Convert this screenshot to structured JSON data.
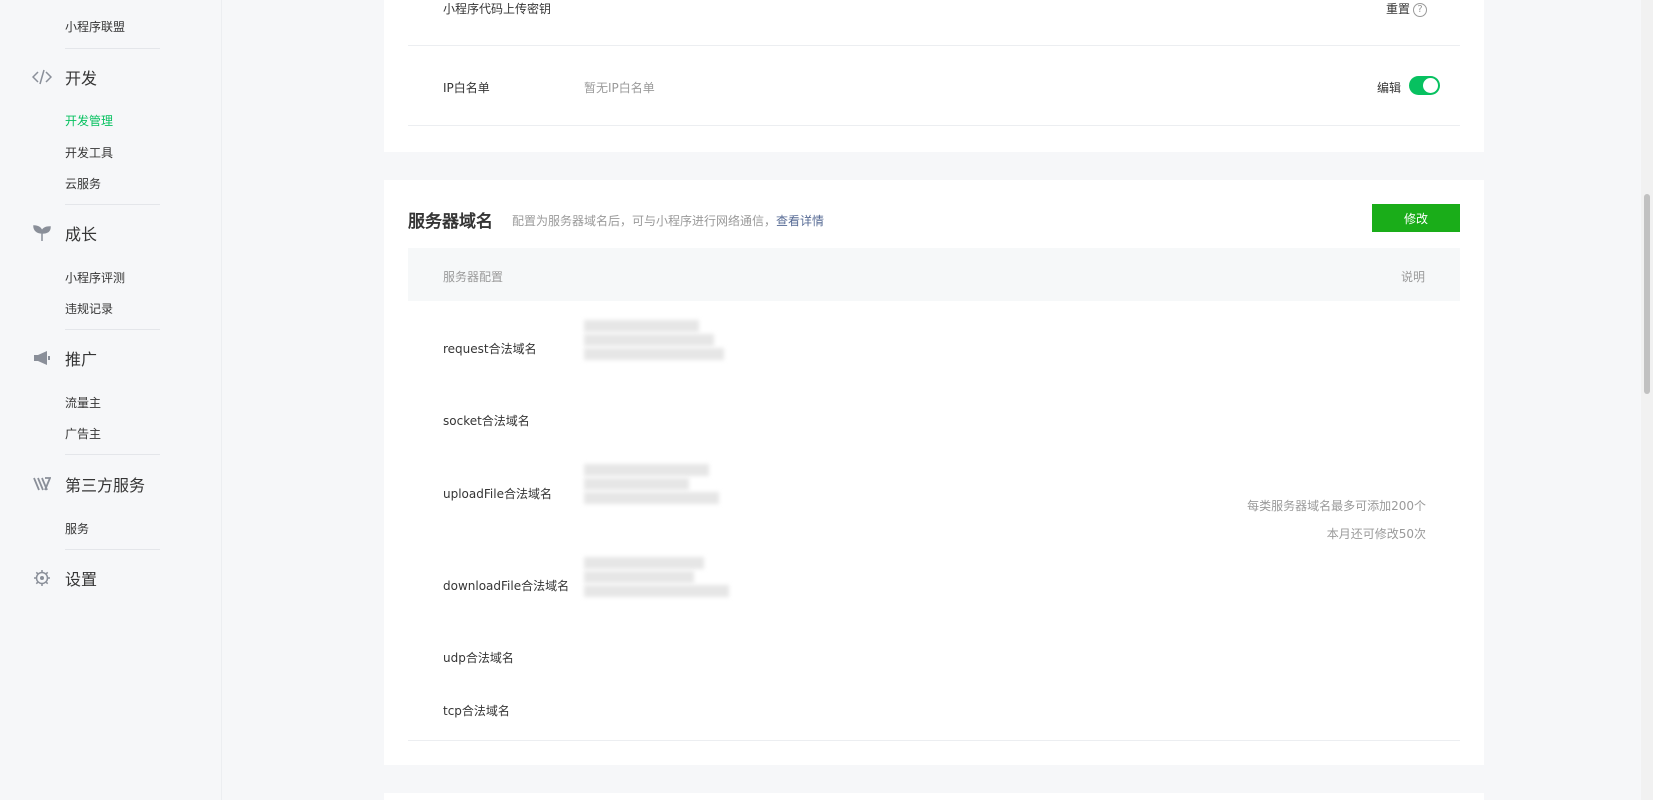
{
  "sidebar": {
    "items": [
      {
        "type": "sub",
        "label": "小程序联盟",
        "active": false
      },
      {
        "type": "group",
        "label": "开发",
        "icon": "code-icon"
      },
      {
        "type": "sub",
        "label": "开发管理",
        "active": true
      },
      {
        "type": "sub",
        "label": "开发工具",
        "active": false
      },
      {
        "type": "sub",
        "label": "云服务",
        "active": false
      },
      {
        "type": "group",
        "label": "成长",
        "icon": "sprout-icon"
      },
      {
        "type": "sub",
        "label": "小程序评测",
        "active": false
      },
      {
        "type": "sub",
        "label": "违规记录",
        "active": false
      },
      {
        "type": "group",
        "label": "推广",
        "icon": "megaphone-icon"
      },
      {
        "type": "sub",
        "label": "流量主",
        "active": false
      },
      {
        "type": "sub",
        "label": "广告主",
        "active": false
      },
      {
        "type": "group",
        "label": "第三方服务",
        "icon": "third-party-icon"
      },
      {
        "type": "sub",
        "label": "服务",
        "active": false
      },
      {
        "type": "group",
        "label": "设置",
        "icon": "gear-icon"
      }
    ]
  },
  "top_card": {
    "secret_label": "小程序代码上传密钥",
    "reset_label": "重置",
    "help_symbol": "?",
    "ip_label": "IP白名单",
    "ip_value": "暂无IP白名单",
    "edit_label": "编辑",
    "toggle_on": true
  },
  "server_card": {
    "title": "服务器域名",
    "desc_prefix": "配置为服务器域名后，可与小程序进行网络通信，",
    "desc_link": "查看详情",
    "modify_label": "修改",
    "header_config": "服务器配置",
    "header_note": "说明",
    "rows": [
      {
        "label": "request合法域名",
        "blurred_lines": 3
      },
      {
        "label": "socket合法域名",
        "blurred_lines": 0
      },
      {
        "label": "uploadFile合法域名",
        "blurred_lines": 3
      },
      {
        "label": "downloadFile合法域名",
        "blurred_lines": 3
      },
      {
        "label": "udp合法域名",
        "blurred_lines": 0
      },
      {
        "label": "tcp合法域名",
        "blurred_lines": 0
      }
    ],
    "note_line1": "每类服务器域名最多可添加200个",
    "note_line2": "本月还可修改50次"
  },
  "colors": {
    "accent": "#07c160",
    "button": "#1aad19",
    "link": "#576b95"
  }
}
